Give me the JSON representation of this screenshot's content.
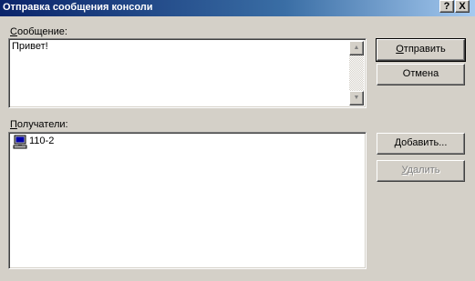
{
  "window": {
    "title": "Отправка сообщения консоли",
    "help_label": "?",
    "close_label": "X"
  },
  "message": {
    "label_prefix": "",
    "label_hotkey": "С",
    "label_rest": "ообщение:",
    "value": "Привет!"
  },
  "recipients": {
    "label_prefix": "",
    "label_hotkey": "П",
    "label_rest": "олучатели:",
    "items": [
      {
        "name": "110-2",
        "icon": "computer-icon"
      }
    ]
  },
  "buttons": {
    "send": {
      "prefix": "",
      "hotkey": "О",
      "rest": "тправить"
    },
    "cancel": {
      "label": "Отмена"
    },
    "add": {
      "prefix": "",
      "hotkey": "Д",
      "rest": "обавить..."
    },
    "remove": {
      "prefix": "",
      "hotkey": "У",
      "rest": "далить",
      "disabled": true
    }
  },
  "colors": {
    "face": "#d4d0c8",
    "title_start": "#0a246a",
    "title_end": "#a6caf0"
  }
}
